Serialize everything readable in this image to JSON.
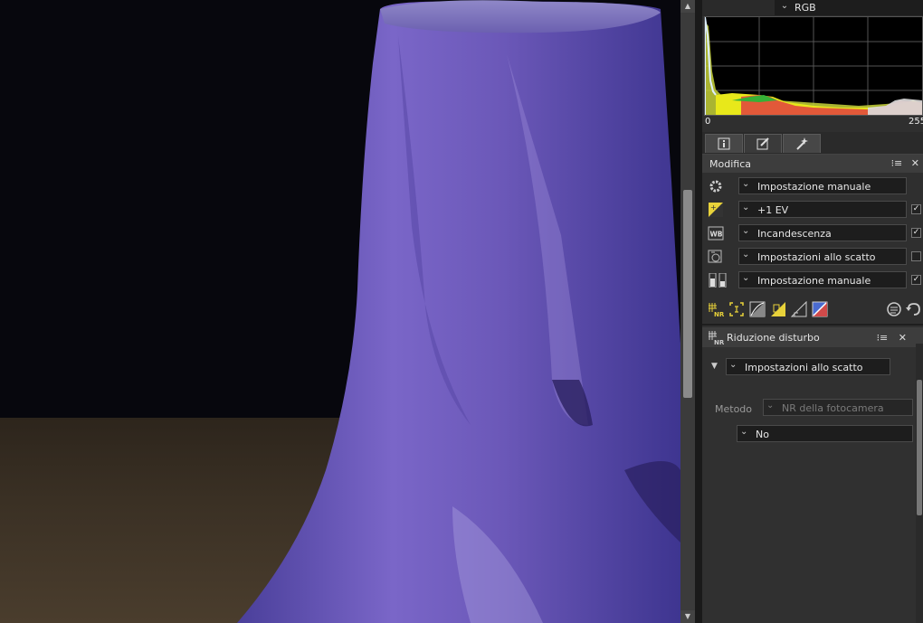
{
  "histogram": {
    "channel": "RGB",
    "min_label": "0",
    "max_label": "255"
  },
  "tabs": [
    {
      "icon": "info-icon"
    },
    {
      "icon": "edit-icon",
      "active": true
    },
    {
      "icon": "magic-wand-icon"
    }
  ],
  "modifica": {
    "title": "Modifica",
    "rows": [
      {
        "icon": "gear-icon",
        "value": "Impostazione manuale",
        "checked": null
      },
      {
        "icon": "exposure-icon",
        "value": "+1 EV",
        "checked": true
      },
      {
        "icon": "wb-icon",
        "value": "Incandescenza",
        "checked": true
      },
      {
        "icon": "picture-control-icon",
        "value": "Impostazioni allo scatto",
        "checked": false
      },
      {
        "icon": "levels-icon",
        "value": "Impostazione manuale",
        "checked": true
      }
    ]
  },
  "noise_reduction": {
    "title": "Riduzione disturbo",
    "preset": "Impostazioni allo scatto",
    "method_label": "Metodo",
    "method_value": "NR della fotocamera",
    "setting_value": "No"
  },
  "colors": {
    "panel_bg": "#2f2f2f",
    "accent_yellow": "#e8d23a"
  }
}
